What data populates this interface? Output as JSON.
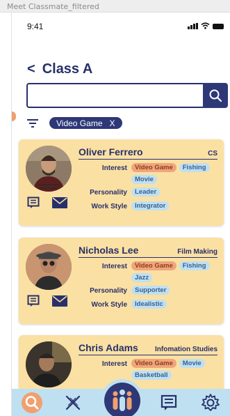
{
  "window": {
    "title": "Meet Classmate_filtered"
  },
  "status_bar": {
    "time": "9:41"
  },
  "header": {
    "back_symbol": "<",
    "title": "Class A"
  },
  "search": {
    "value": "",
    "placeholder": ""
  },
  "filter": {
    "chip_label": "Video Game",
    "chip_close": "X"
  },
  "labels": {
    "interest": "Interest",
    "personality": "Personality",
    "work_style": "Work Style"
  },
  "students": [
    {
      "name": "Oliver Ferrero",
      "major": "CS",
      "interests": [
        "Video Game",
        "Fishing",
        "Movie"
      ],
      "personality": [
        "Leader"
      ],
      "work_style": [
        "Integrator"
      ]
    },
    {
      "name": "Nicholas Lee",
      "major": "Film Making",
      "interests": [
        "Video Game",
        "Fishing",
        "Jazz"
      ],
      "personality": [
        "Supporter"
      ],
      "work_style": [
        "Idealistic"
      ]
    },
    {
      "name": "Chris Adams",
      "major": "Infomation Studies",
      "interests": [
        "Video Game",
        "Movie",
        "Basketball"
      ],
      "personality": [],
      "work_style": []
    }
  ],
  "nav": {
    "items": [
      "search-icon",
      "skills-icon",
      "group-icon",
      "chat-icon",
      "settings-icon"
    ],
    "active": "group-icon"
  },
  "colors": {
    "navy": "#27306a",
    "card": "#fbe0a3",
    "tag": "#bfe0f0",
    "tag_highlight": "#f0a57c",
    "nav_bg": "#bfe0f0",
    "search_icon_accent": "#f0a070"
  }
}
